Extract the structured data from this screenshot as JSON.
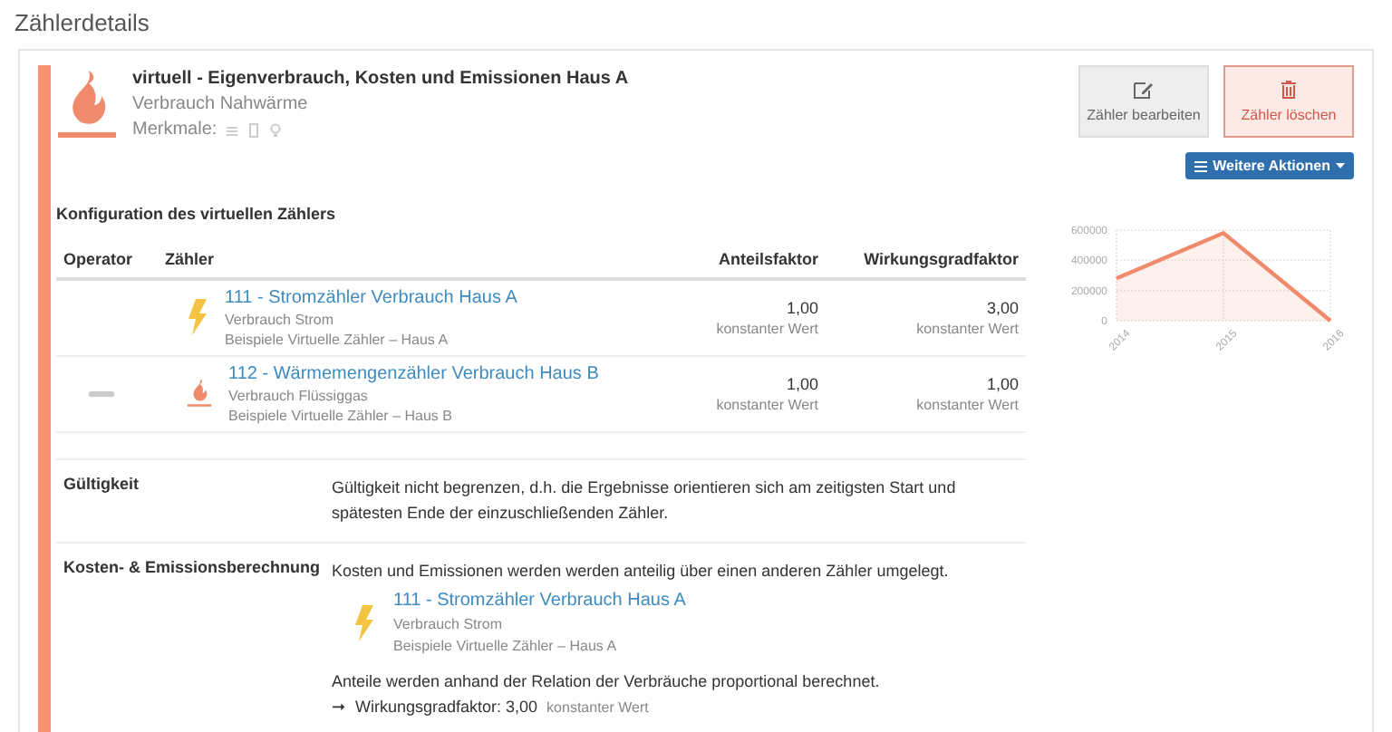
{
  "page_title": "Zählerdetails",
  "meter": {
    "kind": "heat",
    "title": "virtuell - Eigenverbrauch, Kosten und Emissionen Haus A",
    "subtitle": "Verbrauch Nahwärme",
    "features_label": "Merkmale:"
  },
  "actions": {
    "edit": "Zähler bearbeiten",
    "delete": "Zähler löschen",
    "more": "Weitere Aktionen"
  },
  "config": {
    "title": "Konfiguration des virtuellen Zählers",
    "columns": [
      "Operator",
      "Zähler",
      "Anteilsfaktor",
      "Wirkungsgradfaktor"
    ],
    "rows": [
      {
        "kind": "electric",
        "name": "111 - Stromzähler Verbrauch Haus A",
        "type": "Verbrauch Strom",
        "group": "Beispiele Virtuelle Zähler – Haus A",
        "share": "1,00",
        "share_note": "konstanter Wert",
        "efficiency": "3,00",
        "efficiency_note": "konstanter Wert"
      },
      {
        "operator": {
          "kind": "minus"
        },
        "kind": "heat",
        "name": "112 - Wärmemengenzähler Verbrauch Haus B",
        "type": "Verbrauch Flüssiggas",
        "group": "Beispiele Virtuelle Zähler – Haus B",
        "share": "1,00",
        "share_note": "konstanter Wert",
        "efficiency": "1,00",
        "efficiency_note": "konstanter Wert"
      }
    ]
  },
  "validity": {
    "label": "Gültigkeit",
    "text": "Gültigkeit nicht begrenzen, d.h. die Ergebnisse orientieren sich am zeitigsten Start und spätesten Ende der einzuschließenden Zähler."
  },
  "costs": {
    "label": "Kosten- & Emissionsberechnung",
    "text": "Kosten und Emissionen werden werden anteilig über einen anderen Zähler umgelegt.",
    "meter": {
      "kind": "electric",
      "name": "111 - Stromzähler Verbrauch Haus A",
      "type": "Verbrauch Strom",
      "group": "Beispiele Virtuelle Zähler – Haus A"
    },
    "relation": "Anteile werden anhand der Relation der Verbräuche proportional berechnet.",
    "arrow": "➞",
    "factor": "Wirkungsgradfaktor: 3,00",
    "factor_note": "konstanter Wert"
  },
  "chart_data": {
    "type": "area",
    "categories": [
      "2014",
      "2015",
      "2016"
    ],
    "series": [
      {
        "color": "#f08a6c",
        "values": [
          280000,
          580000,
          0
        ]
      }
    ],
    "ylim": [
      0,
      600000
    ],
    "yticks": [
      0,
      200000,
      400000,
      600000
    ]
  }
}
